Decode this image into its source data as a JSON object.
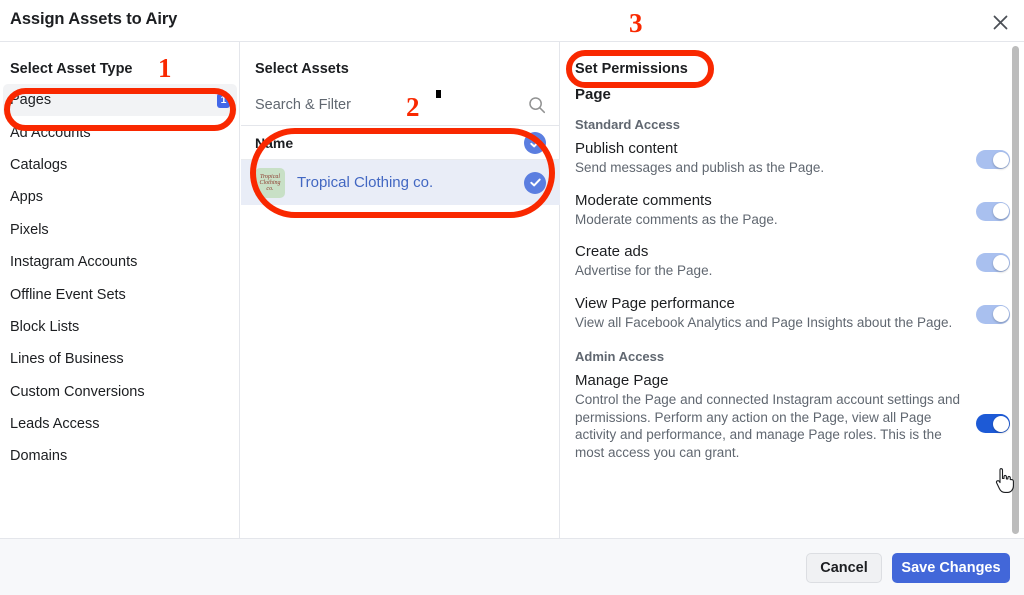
{
  "header": {
    "title": "Assign Assets to Airy",
    "close_icon": "close-icon"
  },
  "left_panel": {
    "heading": "Select Asset Type",
    "items": [
      {
        "label": "Pages",
        "badge": "1",
        "selected": true
      },
      {
        "label": "Ad Accounts",
        "badge": "",
        "selected": false
      },
      {
        "label": "Catalogs",
        "badge": "",
        "selected": false
      },
      {
        "label": "Apps",
        "badge": "",
        "selected": false
      },
      {
        "label": "Pixels",
        "badge": "",
        "selected": false
      },
      {
        "label": "Instagram Accounts",
        "badge": "",
        "selected": false
      },
      {
        "label": "Offline Event Sets",
        "badge": "",
        "selected": false
      },
      {
        "label": "Block Lists",
        "badge": "",
        "selected": false
      },
      {
        "label": "Lines of Business",
        "badge": "",
        "selected": false
      },
      {
        "label": "Custom Conversions",
        "badge": "",
        "selected": false
      },
      {
        "label": "Leads Access",
        "badge": "",
        "selected": false
      },
      {
        "label": "Domains",
        "badge": "",
        "selected": false
      }
    ]
  },
  "middle_panel": {
    "heading": "Select Assets",
    "search": {
      "placeholder": "Search & Filter",
      "value": "",
      "icon": "search-icon"
    },
    "table": {
      "column_header": "Name",
      "header_checked": true,
      "rows": [
        {
          "name": "Tropical Clothing co.",
          "checked": true,
          "thumbnail_alt": "Tropical Clothing co."
        }
      ]
    }
  },
  "right_panel": {
    "heading": "Set Permissions",
    "asset_type_title": "Page",
    "groups": [
      {
        "title": "Standard Access",
        "permissions": [
          {
            "name": "Publish content",
            "description": "Send messages and publish as the Page.",
            "toggle_state": "on",
            "toggle_style": "light"
          },
          {
            "name": "Moderate comments",
            "description": "Moderate comments as the Page.",
            "toggle_state": "on",
            "toggle_style": "light"
          },
          {
            "name": "Create ads",
            "description": "Advertise for the Page.",
            "toggle_state": "on",
            "toggle_style": "light"
          },
          {
            "name": "View Page performance",
            "description": "View all Facebook Analytics and Page Insights about the Page.",
            "toggle_state": "on",
            "toggle_style": "light"
          }
        ]
      },
      {
        "title": "Admin Access",
        "permissions": [
          {
            "name": "Manage Page",
            "description": "Control the Page and connected Instagram account settings and permissions. Perform any action on the Page, view all Page activity and performance, and manage Page roles. This is the most access you can grant.",
            "toggle_state": "on",
            "toggle_style": "strong"
          }
        ]
      }
    ]
  },
  "footer": {
    "cancel_label": "Cancel",
    "save_label": "Save Changes"
  },
  "annotations": {
    "step1": "1",
    "step2": "2",
    "step3": "3",
    "color": "#f92800"
  },
  "colors": {
    "accent_blue": "#4267d9",
    "link_blue": "#4267c2",
    "check_blue": "#5b7ee0",
    "toggle_light": "#a9c0ef",
    "toggle_strong": "#1d5ad6",
    "annotation_red": "#f92800",
    "selected_row": "#e9edf7"
  }
}
